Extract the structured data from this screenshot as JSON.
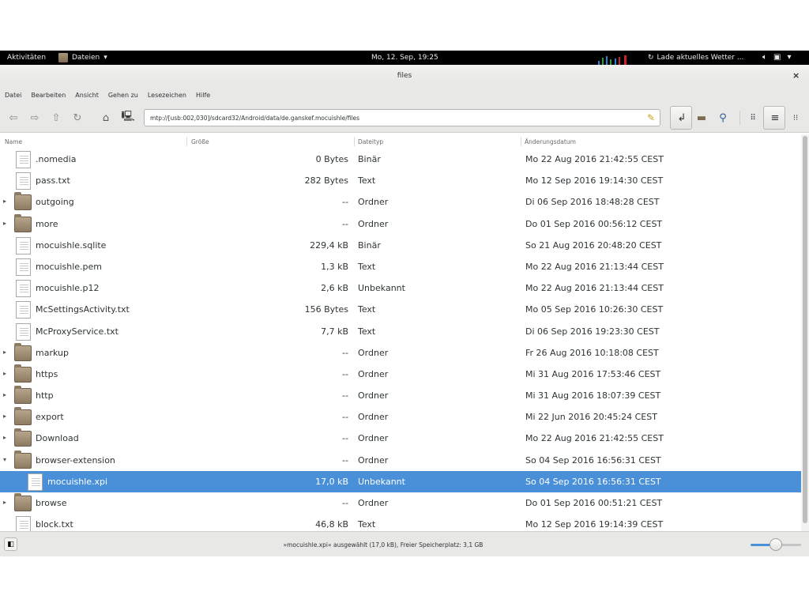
{
  "topbar": {
    "activities": "Aktivitäten",
    "app_menu": "Dateien",
    "clock": "Mo, 12. Sep, 19:25",
    "weather": "Lade aktuelles Wetter ...",
    "weather_icon": "refresh-icon",
    "cpu_graph_color": "#2e7fd6"
  },
  "window": {
    "title": "files",
    "close": "×"
  },
  "menubar": [
    "Datei",
    "Bearbeiten",
    "Ansicht",
    "Gehen zu",
    "Lesezeichen",
    "Hilfe"
  ],
  "toolbar": {
    "location": "mtp://[usb:002,030]/sdcard32/Android/data/de.ganskef.mocuishle/files",
    "icons": [
      "back-icon",
      "forward-icon",
      "up-icon",
      "reload-icon",
      "home-icon",
      "computer-icon",
      "clear-location-icon",
      "toggle-location-icon",
      "new-folder-icon",
      "search-icon",
      "grid-view-icon",
      "list-view-icon",
      "compact-view-icon"
    ]
  },
  "columns": {
    "name": "Name",
    "size": "Größe",
    "type": "Dateityp",
    "date": "Änderungsdatum"
  },
  "files": [
    {
      "name": ".nomedia",
      "size": "0 Bytes",
      "type": "Binär",
      "date": "Mo 22 Aug 2016 21:42:55 CEST",
      "kind": "file",
      "expander": ""
    },
    {
      "name": "pass.txt",
      "size": "282 Bytes",
      "type": "Text",
      "date": "Mo 12 Sep 2016 19:14:30 CEST",
      "kind": "file",
      "expander": ""
    },
    {
      "name": "outgoing",
      "size": "--",
      "type": "Ordner",
      "date": "Di 06 Sep 2016 18:48:28 CEST",
      "kind": "folder",
      "expander": "▸"
    },
    {
      "name": "more",
      "size": "--",
      "type": "Ordner",
      "date": "Do 01 Sep 2016 00:56:12 CEST",
      "kind": "folder",
      "expander": "▸"
    },
    {
      "name": "mocuishle.sqlite",
      "size": "229,4 kB",
      "type": "Binär",
      "date": "So 21 Aug 2016 20:48:20 CEST",
      "kind": "file",
      "expander": ""
    },
    {
      "name": "mocuishle.pem",
      "size": "1,3 kB",
      "type": "Text",
      "date": "Mo 22 Aug 2016 21:13:44 CEST",
      "kind": "file",
      "expander": ""
    },
    {
      "name": "mocuishle.p12",
      "size": "2,6 kB",
      "type": "Unbekannt",
      "date": "Mo 22 Aug 2016 21:13:44 CEST",
      "kind": "file",
      "expander": ""
    },
    {
      "name": "McSettingsActivity.txt",
      "size": "156 Bytes",
      "type": "Text",
      "date": "Mo 05 Sep 2016 10:26:30 CEST",
      "kind": "file",
      "expander": ""
    },
    {
      "name": "McProxyService.txt",
      "size": "7,7 kB",
      "type": "Text",
      "date": "Di 06 Sep 2016 19:23:30 CEST",
      "kind": "file",
      "expander": ""
    },
    {
      "name": "markup",
      "size": "--",
      "type": "Ordner",
      "date": "Fr 26 Aug 2016 10:18:08 CEST",
      "kind": "folder",
      "expander": "▸"
    },
    {
      "name": "https",
      "size": "--",
      "type": "Ordner",
      "date": "Mi 31 Aug 2016 17:53:46 CEST",
      "kind": "folder",
      "expander": "▸"
    },
    {
      "name": "http",
      "size": "--",
      "type": "Ordner",
      "date": "Mi 31 Aug 2016 18:07:39 CEST",
      "kind": "folder",
      "expander": "▸"
    },
    {
      "name": "export",
      "size": "--",
      "type": "Ordner",
      "date": "Mi 22 Jun 2016 20:45:24 CEST",
      "kind": "folder",
      "expander": "▸"
    },
    {
      "name": "Download",
      "size": "--",
      "type": "Ordner",
      "date": "Mo 22 Aug 2016 21:42:55 CEST",
      "kind": "folder",
      "expander": "▸"
    },
    {
      "name": "browser-extension",
      "size": "--",
      "type": "Ordner",
      "date": "So 04 Sep 2016 16:56:31 CEST",
      "kind": "folder",
      "expander": "▾"
    },
    {
      "name": "mocuishle.xpi",
      "size": "17,0 kB",
      "type": "Unbekannt",
      "date": "So 04 Sep 2016 16:56:31 CEST",
      "kind": "file",
      "expander": "",
      "selected": true,
      "indent": 1
    },
    {
      "name": "browse",
      "size": "--",
      "type": "Ordner",
      "date": "Do 01 Sep 2016 00:51:21 CEST",
      "kind": "folder",
      "expander": "▸"
    },
    {
      "name": "block.txt",
      "size": "46,8 kB",
      "type": "Text",
      "date": "Mo 12 Sep 2016 19:14:39 CEST",
      "kind": "file",
      "expander": ""
    }
  ],
  "status": {
    "text": "»mocuishle.xpi« ausgewählt (17,0 kB), Freier Speicherplatz: 3,1 GB",
    "pane_icon": "sidebar-toggle-icon",
    "zoom_level": 0.5
  },
  "colors": {
    "selection": "#4a90d9",
    "topbar": "#000000"
  }
}
